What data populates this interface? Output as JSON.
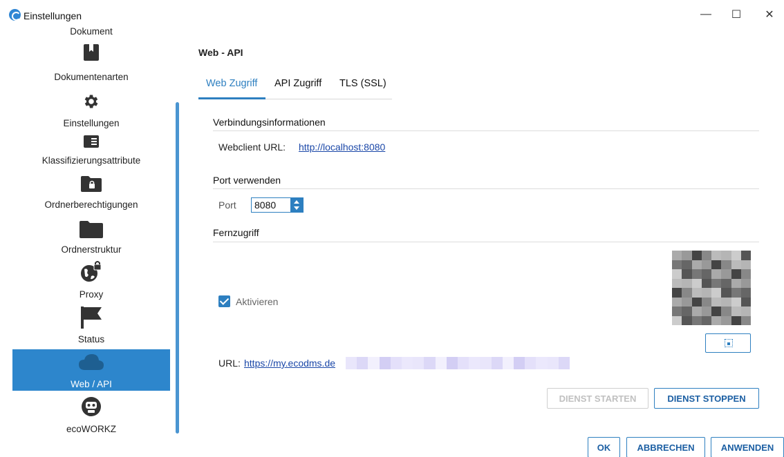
{
  "window": {
    "title": "Einstellungen",
    "minimize": "—",
    "maximize": "☐",
    "close": "✕"
  },
  "sidebar": {
    "items": [
      {
        "label": "Dokument",
        "icon": "document-icon"
      },
      {
        "label": "Dokumentenarten",
        "icon": "bookmark-icon"
      },
      {
        "label": "Einstellungen",
        "icon": "gear-icon"
      },
      {
        "label": "Klassifizierungsattribute",
        "icon": "list-card-icon"
      },
      {
        "label": "Ordnerberechtigungen",
        "icon": "folder-lock-icon"
      },
      {
        "label": "Ordnerstruktur",
        "icon": "folder-icon"
      },
      {
        "label": "Proxy",
        "icon": "globe-lock-icon"
      },
      {
        "label": "Status",
        "icon": "flag-icon"
      },
      {
        "label": "Web / API",
        "icon": "cloud-icon",
        "active": true
      },
      {
        "label": "ecoWORKZ",
        "icon": "robot-icon"
      }
    ],
    "active_color": "#2d86cc"
  },
  "main": {
    "heading": "Web - API",
    "tabs": [
      {
        "label": "Web Zugriff",
        "active": true
      },
      {
        "label": "API Zugriff"
      },
      {
        "label": "TLS (SSL)"
      }
    ],
    "connection": {
      "title": "Verbindungsinformationen",
      "webclient_label": "Webclient URL:",
      "webclient_url": "http://localhost:8080"
    },
    "port_section": {
      "title": "Port verwenden",
      "port_label": "Port",
      "port_value": "8080"
    },
    "remote": {
      "title": "Fernzugriff",
      "activate_label": "Aktivieren",
      "activate_checked": true,
      "url_label": "URL:",
      "url_value": "https://my.ecodms.de"
    },
    "buttons": {
      "start_service": "DIENST STARTEN",
      "stop_service": "DIENST STOPPEN"
    }
  },
  "footer": {
    "ok": "OK",
    "cancel": "ABBRECHEN",
    "apply": "ANWENDEN"
  },
  "colors": {
    "accent": "#2d7fc0",
    "link": "#1a47a8"
  }
}
